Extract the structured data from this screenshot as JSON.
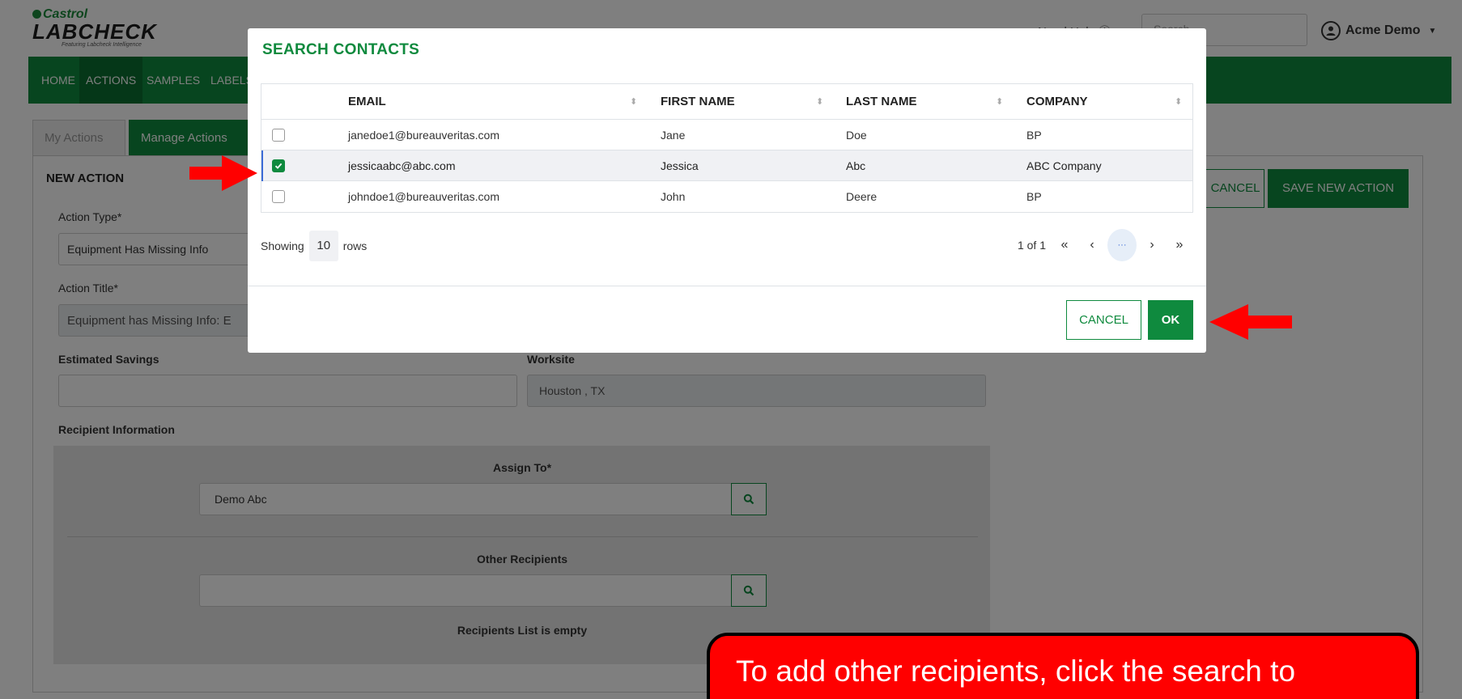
{
  "header": {
    "brand": "Castrol",
    "product": "LABCHECK",
    "tagline": "Featuring Labcheck Intelligence",
    "need_help": "Need Help ⓘ",
    "search_placeholder": "Search...",
    "user_name": "Acme Demo"
  },
  "nav": {
    "items": [
      "HOME",
      "ACTIONS",
      "SAMPLES",
      "LABELS"
    ],
    "active": "ACTIONS"
  },
  "tabs": {
    "my_actions": "My Actions",
    "manage_actions": "Manage Actions"
  },
  "form": {
    "title": "NEW ACTION",
    "cancel_label": "CANCEL",
    "save_label": "SAVE NEW ACTION",
    "action_type_label": "Action Type*",
    "action_type_value": "Equipment Has Missing Info",
    "action_title_label": "Action Title*",
    "action_title_value": "Equipment has Missing Info: E",
    "estimated_savings_label": "Estimated Savings",
    "estimated_savings_value": "",
    "worksite_label": "Worksite",
    "worksite_value": "Houston , TX",
    "recipient_section_label": "Recipient Information",
    "assign_to_label": "Assign To*",
    "assign_to_value": "Demo Abc",
    "other_recipients_label": "Other Recipients",
    "other_recipients_value": "",
    "recipients_empty": "Recipients List is empty"
  },
  "modal": {
    "title": "SEARCH CONTACTS",
    "columns": {
      "email": "EMAIL",
      "first_name": "FIRST NAME",
      "last_name": "LAST NAME",
      "company": "COMPANY"
    },
    "rows": [
      {
        "email": "janedoe1@bureauveritas.com",
        "first": "Jane",
        "last": "Doe",
        "company": "BP",
        "checked": false
      },
      {
        "email": "jessicaabc@abc.com",
        "first": "Jessica",
        "last": "Abc",
        "company": "ABC Company",
        "checked": true
      },
      {
        "email": "johndoe1@bureauveritas.com",
        "first": "John",
        "last": "Deere",
        "company": "BP",
        "checked": false
      }
    ],
    "showing_prefix": "Showing",
    "rows_per_page": "10",
    "showing_suffix": "rows",
    "page_info": "1 of 1",
    "pager": {
      "first": "«",
      "prev": "‹",
      "current": "···",
      "next": "›",
      "last": "»"
    },
    "cancel_label": "CANCEL",
    "ok_label": "OK"
  },
  "annotation": {
    "callout_text": "To add other recipients, click the search to",
    "arrow_color": "#ff0000"
  },
  "colors": {
    "brand_green": "#0f8a3e",
    "nav_active": "#0a6e30",
    "callout_red": "#ff0000"
  }
}
